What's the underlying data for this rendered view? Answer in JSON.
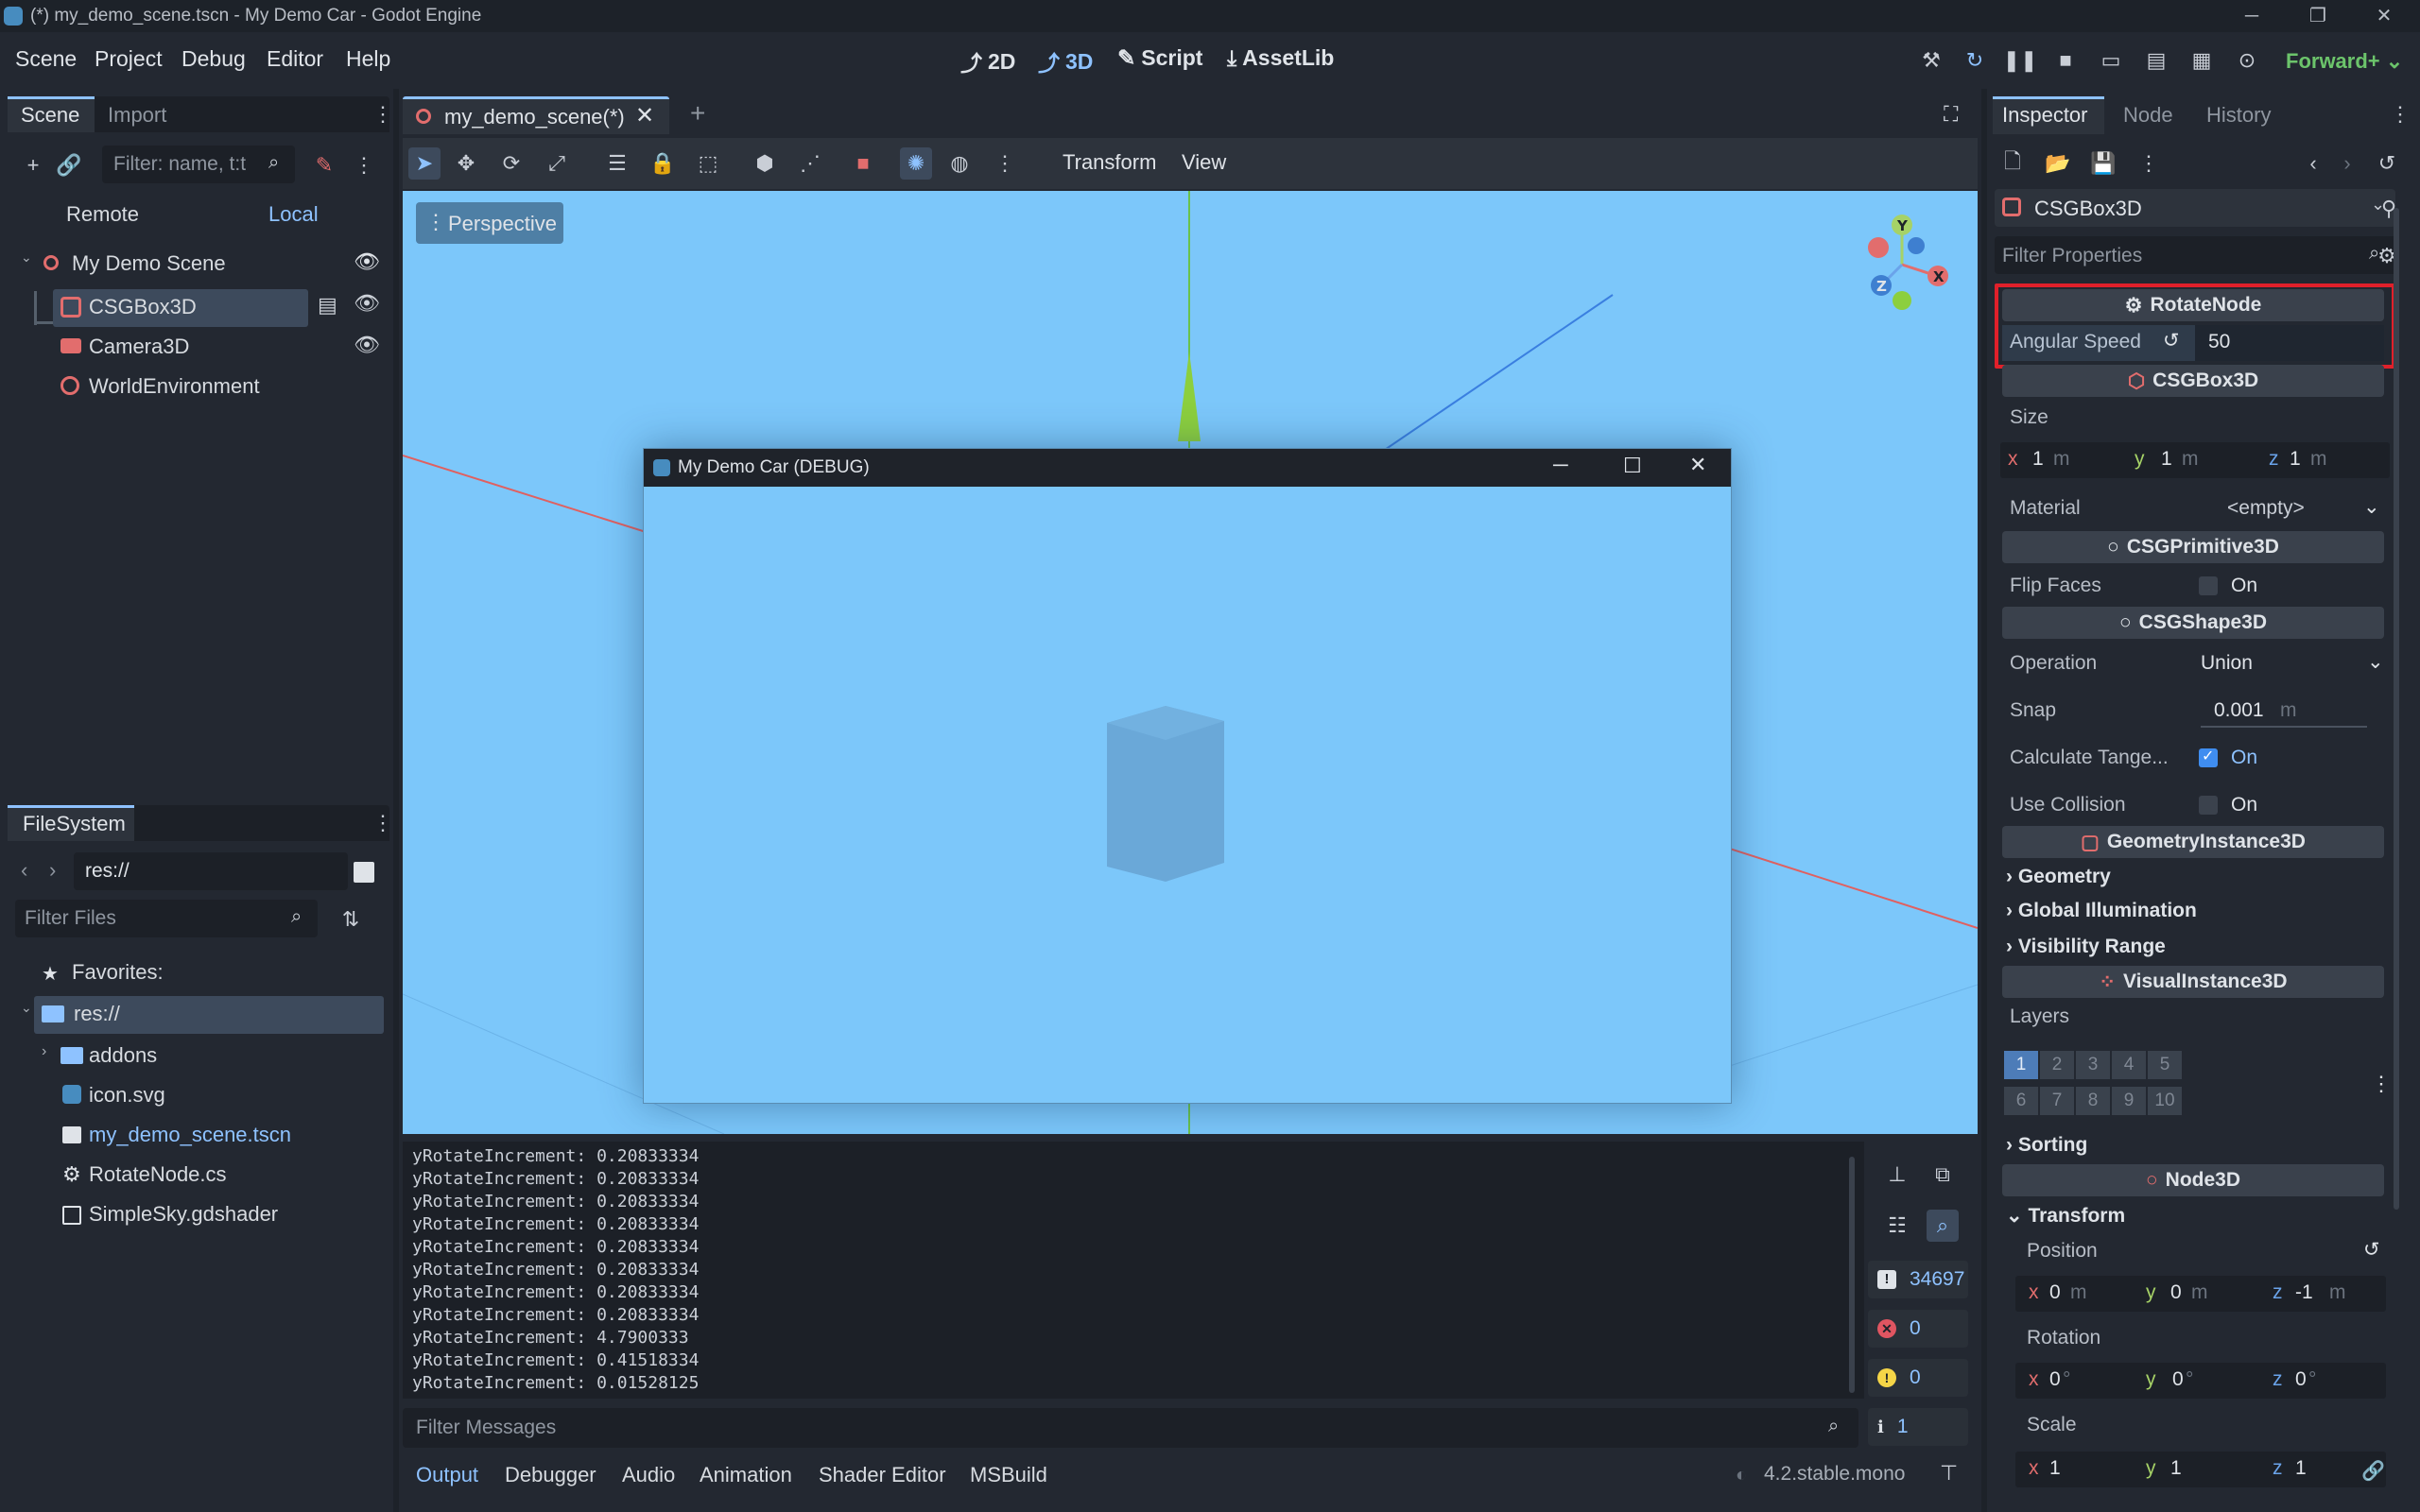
{
  "window": {
    "title": "(*) my_demo_scene.tscn - My Demo Car - Godot Engine"
  },
  "menubar": {
    "menus": [
      "Scene",
      "Project",
      "Debug",
      "Editor",
      "Help"
    ],
    "workspaces": [
      "2D",
      "3D",
      "Script",
      "AssetLib"
    ],
    "active_workspace": "3D",
    "renderer": "Forward+"
  },
  "scene_dock": {
    "tabs": [
      "Scene",
      "Import"
    ],
    "filter_placeholder": "Filter: name, t:t",
    "remote_label": "Remote",
    "local_label": "Local",
    "tree": [
      {
        "name": "My Demo Scene",
        "icon": "node3d-icon"
      },
      {
        "name": "CSGBox3D",
        "icon": "csgbox-icon"
      },
      {
        "name": "Camera3D",
        "icon": "camera-icon"
      },
      {
        "name": "WorldEnvironment",
        "icon": "globe-icon"
      }
    ]
  },
  "filesystem_dock": {
    "tab": "FileSystem",
    "path": "res://",
    "filter_placeholder": "Filter Files",
    "favorites_label": "Favorites:",
    "items": [
      {
        "name": "res://",
        "icon": "folder-icon"
      },
      {
        "name": "addons",
        "icon": "folder-icon"
      },
      {
        "name": "icon.svg",
        "icon": "image-icon"
      },
      {
        "name": "my_demo_scene.tscn",
        "icon": "scene-icon"
      },
      {
        "name": "RotateNode.cs",
        "icon": "script-icon"
      },
      {
        "name": "SimpleSky.gdshader",
        "icon": "shader-icon"
      }
    ]
  },
  "editor_tabs": {
    "open_tab": "my_demo_scene(*)"
  },
  "viewport": {
    "toolbar_menus": [
      "Transform",
      "View"
    ],
    "perspective_label": "Perspective",
    "gizmo": {
      "x": "X",
      "y": "Y",
      "z": "Z"
    }
  },
  "game_window": {
    "title": "My Demo Car (DEBUG)"
  },
  "output": {
    "lines": [
      "yRotateIncrement: 0.20833334",
      "yRotateIncrement: 0.20833334",
      "yRotateIncrement: 0.20833334",
      "yRotateIncrement: 0.20833334",
      "yRotateIncrement: 0.20833334",
      "yRotateIncrement: 0.20833334",
      "yRotateIncrement: 0.20833334",
      "yRotateIncrement: 0.20833334",
      "yRotateIncrement: 4.7900333",
      "yRotateIncrement: 0.41518334",
      "yRotateIncrement: 0.01528125"
    ],
    "filter_placeholder": "Filter Messages",
    "counts": {
      "messages": "34697",
      "errors": "0",
      "warnings": "0",
      "editor": "1"
    },
    "bottom_tabs": [
      "Output",
      "Debugger",
      "Audio",
      "Animation",
      "Shader Editor",
      "MSBuild"
    ],
    "version": "4.2.stable.mono"
  },
  "inspector": {
    "tabs": [
      "Inspector",
      "Node",
      "History"
    ],
    "object": "CSGBox3D",
    "filter_placeholder": "Filter Properties",
    "rotate_node": {
      "header": "RotateNode",
      "prop": "Angular Speed",
      "value": "50"
    },
    "csgbox": {
      "header": "CSGBox3D",
      "size_label": "Size",
      "size": {
        "x": "1",
        "y": "1",
        "z": "1",
        "unit": "m"
      },
      "material_label": "Material",
      "material_value": "<empty>"
    },
    "csgprimitive": {
      "header": "CSGPrimitive3D",
      "flip_label": "Flip Faces",
      "flip_value": "On"
    },
    "csgshape": {
      "header": "CSGShape3D",
      "operation_label": "Operation",
      "operation_value": "Union",
      "snap_label": "Snap",
      "snap_value": "0.001",
      "snap_unit": "m",
      "tangents_label": "Calculate Tange...",
      "tangents_value": "On",
      "collision_label": "Use Collision",
      "collision_value": "On"
    },
    "geometry": {
      "header": "GeometryInstance3D",
      "groups": [
        "Geometry",
        "Global Illumination",
        "Visibility Range"
      ]
    },
    "visual": {
      "header": "VisualInstance3D",
      "layers_label": "Layers",
      "layers": [
        "1",
        "2",
        "3",
        "4",
        "5",
        "6",
        "7",
        "8",
        "9",
        "10"
      ],
      "sorting": "Sorting"
    },
    "node3d": {
      "header": "Node3D",
      "transform": "Transform",
      "position_label": "Position",
      "position": {
        "x": "0",
        "y": "0",
        "z": "-1",
        "unit": "m"
      },
      "rotation_label": "Rotation",
      "rotation": {
        "x": "0",
        "y": "0",
        "z": "0",
        "unit": "°"
      },
      "scale_label": "Scale",
      "scale": {
        "x": "1",
        "y": "1",
        "z": "1"
      }
    }
  },
  "colors": {
    "accent": "#8ec2ff",
    "sky": "#7cc7fa",
    "highlight_red": "#e0202a"
  }
}
